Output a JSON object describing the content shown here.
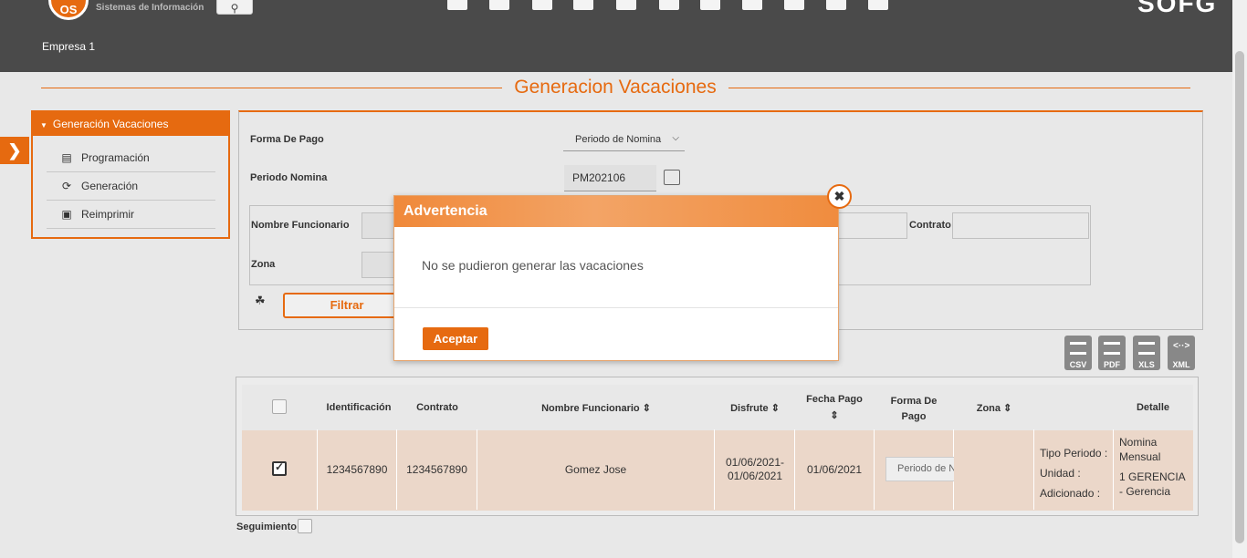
{
  "header": {
    "logo_text": "OS",
    "logo_subtitle": "Sistemas de Información",
    "brand": "SOFG",
    "company": "Empresa 1",
    "top_icons": [
      "edit-doc-icon",
      "people-icon",
      "gift-icon",
      "org-chart-icon",
      "transfer-icon",
      "history-icon",
      "document-list-icon",
      "tools-icon",
      "settings-gears-icon",
      "location-settings-icon",
      "handshake-icon"
    ]
  },
  "page": {
    "title": "Generacion Vacaciones"
  },
  "sidebar": {
    "header": "Generación Vacaciones",
    "items": [
      {
        "label": "Programación",
        "icon": "monitor-icon"
      },
      {
        "label": "Generación",
        "icon": "refresh-icon"
      },
      {
        "label": "Reimprimir",
        "icon": "printer-icon"
      }
    ]
  },
  "filters": {
    "forma_pago_label": "Forma De Pago",
    "forma_pago_value": "Periodo de Nomina",
    "periodo_nomina_label": "Periodo Nomina",
    "periodo_nomina_value": "PM202106",
    "nombre_funcionario_label": "Nombre Funcionario",
    "contrato_label": "Contrato",
    "zona_label": "Zona",
    "filtrar_label": "Filtrar"
  },
  "exports": [
    "CSV",
    "PDF",
    "XLS",
    "XML"
  ],
  "table": {
    "headers": {
      "identificacion": "Identificación",
      "contrato": "Contrato",
      "nombre": "Nombre Funcionario",
      "disfrute": "Disfrute",
      "fecha_pago": "Fecha Pago",
      "forma_pago": "Forma De Pago",
      "zona": "Zona",
      "detalle": "Detalle"
    },
    "row": {
      "checked": true,
      "identificacion": "1234567890",
      "contrato": "1234567890",
      "nombre": "Gomez Jose",
      "disfrute": "01/06/2021-01/06/2021",
      "fecha_pago": "01/06/2021",
      "forma_pago": "Periodo de Nomina",
      "zona": "",
      "detail_labels": [
        "Tipo Periodo :",
        "Unidad :",
        "Adicionado :"
      ],
      "detail_values": [
        "Nomina Mensual",
        "1 GERENCIA - Gerencia"
      ]
    }
  },
  "seguimiento_label": "Seguimiento",
  "modal": {
    "title": "Advertencia",
    "message": "No se pudieron generar las vacaciones",
    "accept_label": "Aceptar"
  }
}
